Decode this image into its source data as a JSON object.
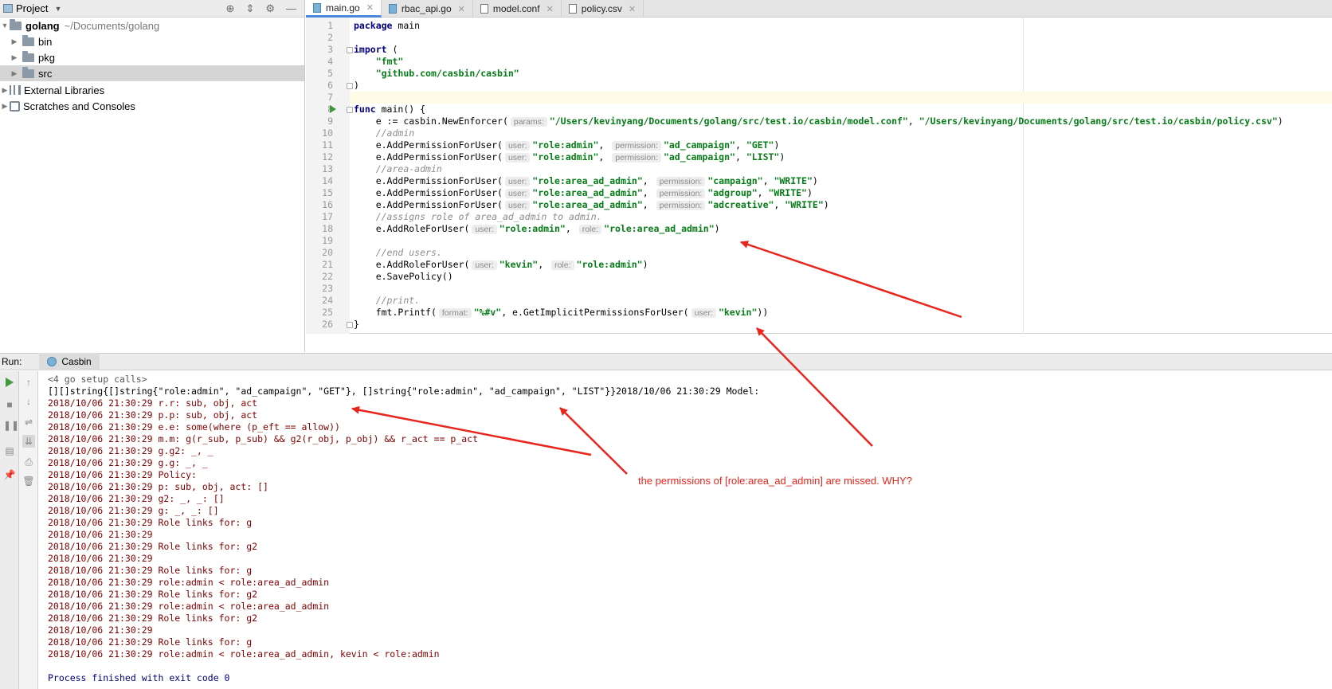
{
  "project": {
    "title": "Project",
    "root_name": "golang",
    "root_path": "~/Documents/golang",
    "items": [
      {
        "label": "bin"
      },
      {
        "label": "pkg"
      },
      {
        "label": "src"
      }
    ],
    "external_libraries": "External Libraries",
    "scratches": "Scratches and Consoles"
  },
  "tabs": [
    {
      "label": "main.go",
      "active": true
    },
    {
      "label": "rbac_api.go"
    },
    {
      "label": "model.conf"
    },
    {
      "label": "policy.csv"
    }
  ],
  "editor": {
    "line_numbers": [
      "1",
      "2",
      "3",
      "4",
      "5",
      "6",
      "7",
      "8",
      "9",
      "10",
      "11",
      "12",
      "13",
      "14",
      "15",
      "16",
      "17",
      "18",
      "19",
      "20",
      "21",
      "22",
      "23",
      "24",
      "25",
      "26"
    ],
    "lines": {
      "l1_kw": "package",
      "l1_rest": " main",
      "l3_kw": "import",
      "l3_rest": " (",
      "l4": "\"fmt\"",
      "l5": "\"github.com/casbin/casbin\"",
      "l6": ")",
      "l8_kw": "func",
      "l8_rest": " main() {",
      "l9_a": "e := casbin.NewEnforcer(",
      "l9_hint": "params:",
      "l9_s1": "\"/Users/kevinyang/Documents/golang/src/test.io/casbin/model.conf\"",
      "l9_s2": "\"/Users/kevinyang/Documents/golang/src/test.io/casbin/policy.csv\"",
      "l10": "//admin",
      "l11_a": "e.AddPermissionForUser(",
      "l11_h1": "user:",
      "l11_s1": "\"role:admin\"",
      "l11_h2": "permission:",
      "l11_s2": "\"ad_campaign\"",
      "l11_s3": "\"GET\"",
      "l12_a": "e.AddPermissionForUser(",
      "l12_h1": "user:",
      "l12_s1": "\"role:admin\"",
      "l12_h2": "permission:",
      "l12_s2": "\"ad_campaign\"",
      "l12_s3": "\"LIST\"",
      "l13": "//area-admin",
      "l14_a": "e.AddPermissionForUser(",
      "l14_h1": "user:",
      "l14_s1": "\"role:area_ad_admin\"",
      "l14_h2": "permission:",
      "l14_s2": "\"campaign\"",
      "l14_s3": "\"WRITE\"",
      "l15_a": "e.AddPermissionForUser(",
      "l15_h1": "user:",
      "l15_s1": "\"role:area_ad_admin\"",
      "l15_h2": "permission:",
      "l15_s2": "\"adgroup\"",
      "l15_s3": "\"WRITE\"",
      "l16_a": "e.AddPermissionForUser(",
      "l16_h1": "user:",
      "l16_s1": "\"role:area_ad_admin\"",
      "l16_h2": "permission:",
      "l16_s2": "\"adcreative\"",
      "l16_s3": "\"WRITE\"",
      "l17": "//assigns role of area_ad_admin to admin.",
      "l18_a": "e.AddRoleForUser(",
      "l18_h1": "user:",
      "l18_s1": "\"role:admin\"",
      "l18_h2": "role:",
      "l18_s2": "\"role:area_ad_admin\"",
      "l20": "//end users.",
      "l21_a": "e.AddRoleForUser(",
      "l21_h1": "user:",
      "l21_s1": "\"kevin\"",
      "l21_h2": "role:",
      "l21_s2": "\"role:admin\"",
      "l22": "e.SavePolicy()",
      "l24": "//print.",
      "l25_a": "fmt.Printf(",
      "l25_h1": "format:",
      "l25_s1": "\"%#v\"",
      "l25_b": ", e.GetImplicitPermissionsForUser(",
      "l25_h2": "user:",
      "l25_s2": "\"kevin\"",
      "l26": "}"
    }
  },
  "run": {
    "label": "Run:",
    "tab": "Casbin",
    "output": [
      "<4 go setup calls>",
      "[][]string{[]string{\"role:admin\", \"ad_campaign\", \"GET\"}, []string{\"role:admin\", \"ad_campaign\", \"LIST\"}}2018/10/06 21:30:29 Model:",
      "2018/10/06 21:30:29 r.r: sub, obj, act",
      "2018/10/06 21:30:29 p.p: sub, obj, act",
      "2018/10/06 21:30:29 e.e: some(where (p_eft == allow))",
      "2018/10/06 21:30:29 m.m: g(r_sub, p_sub) && g2(r_obj, p_obj) && r_act == p_act",
      "2018/10/06 21:30:29 g.g2: _, _",
      "2018/10/06 21:30:29 g.g: _, _",
      "2018/10/06 21:30:29 Policy:",
      "2018/10/06 21:30:29 p: sub, obj, act: []",
      "2018/10/06 21:30:29 g2: _, _: []",
      "2018/10/06 21:30:29 g: _, _: []",
      "2018/10/06 21:30:29 Role links for: g",
      "2018/10/06 21:30:29",
      "2018/10/06 21:30:29 Role links for: g2",
      "2018/10/06 21:30:29",
      "2018/10/06 21:30:29 Role links for: g",
      "2018/10/06 21:30:29 role:admin < role:area_ad_admin",
      "2018/10/06 21:30:29 Role links for: g2",
      "2018/10/06 21:30:29 role:admin < role:area_ad_admin",
      "2018/10/06 21:30:29 Role links for: g2",
      "2018/10/06 21:30:29",
      "2018/10/06 21:30:29 Role links for: g",
      "2018/10/06 21:30:29 role:admin < role:area_ad_admin, kevin < role:admin",
      "",
      "Process finished with exit code 0"
    ]
  },
  "annotation": {
    "text": "the permissions of [role:area_ad_admin] are missed. WHY?",
    "color": "#e8261d"
  }
}
